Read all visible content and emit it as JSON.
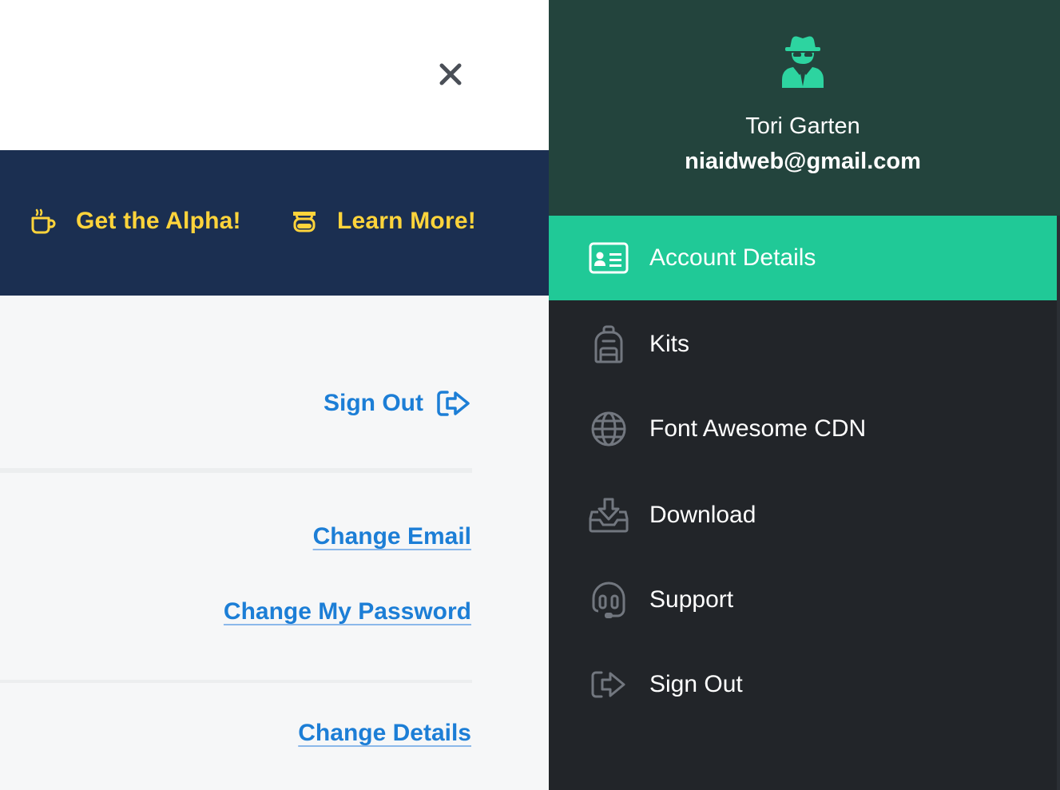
{
  "banner": {
    "alpha_label": "Get the Alpha!",
    "learn_label": "Learn More!"
  },
  "account": {
    "signout_label": "Sign Out",
    "change_email_label": "Change Email",
    "change_password_label": "Change My Password",
    "change_details_label": "Change Details"
  },
  "drawer": {
    "user_name": "Tori Garten",
    "user_email": "niaidweb@gmail.com",
    "menu": [
      {
        "label": "Account Details",
        "icon": "id-card-icon",
        "active": true
      },
      {
        "label": "Kits",
        "icon": "backpack-icon",
        "active": false
      },
      {
        "label": "Font Awesome CDN",
        "icon": "globe-icon",
        "active": false
      },
      {
        "label": "Download",
        "icon": "inbox-download-icon",
        "active": false
      },
      {
        "label": "Support",
        "icon": "headset-icon",
        "active": false
      },
      {
        "label": "Sign Out",
        "icon": "sign-out-icon",
        "active": false
      }
    ]
  },
  "colors": {
    "banner_bg": "#1b2f51",
    "banner_text": "#ffd43b",
    "link": "#1c7ed6",
    "drawer_header_bg": "#23443d",
    "drawer_bg": "#222529",
    "active_item_bg": "#20c997",
    "avatar": "#2dd4a0"
  }
}
